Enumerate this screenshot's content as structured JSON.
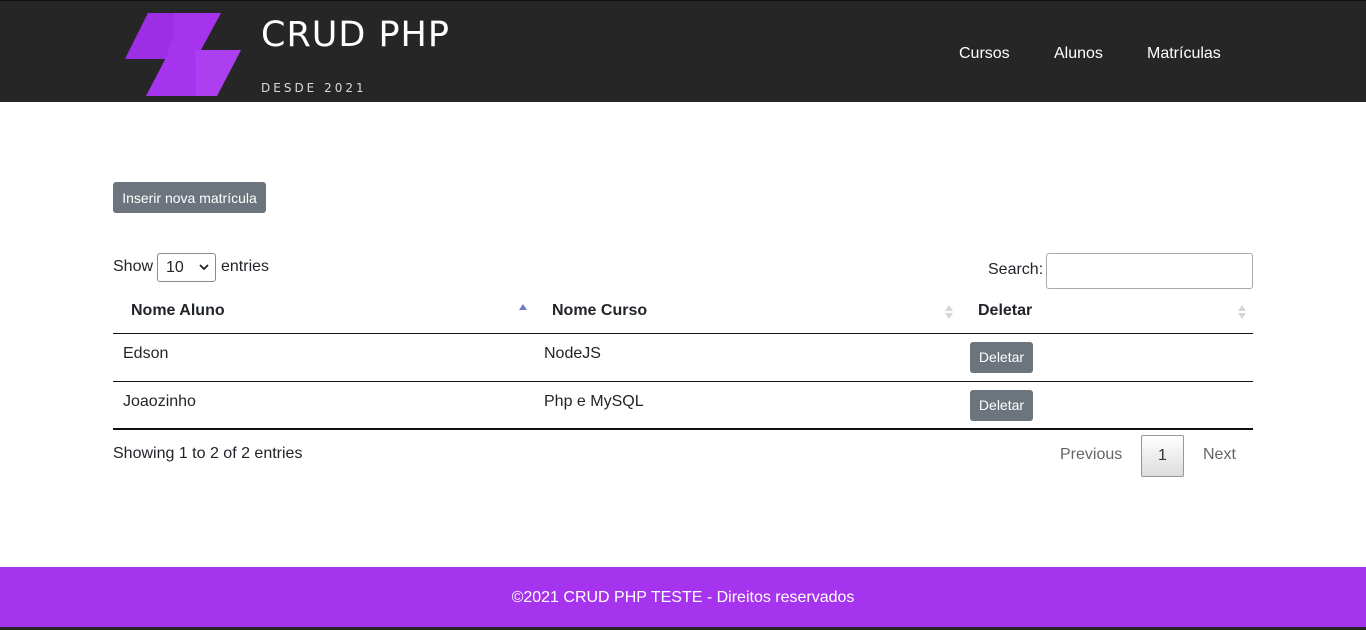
{
  "header": {
    "brand_title": "CRUD PHP",
    "brand_subtitle": "DESDE 2021",
    "logo_color": "#a634ee",
    "nav": [
      {
        "label": "Cursos"
      },
      {
        "label": "Alunos"
      },
      {
        "label": "Matrículas"
      }
    ]
  },
  "main": {
    "insert_button": "Inserir nova matrícula",
    "length": {
      "show_label": "Show",
      "selected": "10",
      "entries_label": "entries"
    },
    "search": {
      "label": "Search:",
      "value": ""
    },
    "table": {
      "columns": [
        "Nome Aluno",
        "Nome Curso",
        "Deletar"
      ],
      "rows": [
        {
          "aluno": "Edson",
          "curso": "NodeJS",
          "action": "Deletar"
        },
        {
          "aluno": "Joaozinho",
          "curso": "Php e MySQL",
          "action": "Deletar"
        }
      ]
    },
    "info": "Showing 1 to 2 of 2 entries",
    "pagination": {
      "previous": "Previous",
      "current": "1",
      "next": "Next"
    }
  },
  "footer": {
    "text": "©2021 CRUD PHP TESTE - Direitos reservados",
    "color": "#a634ee"
  }
}
